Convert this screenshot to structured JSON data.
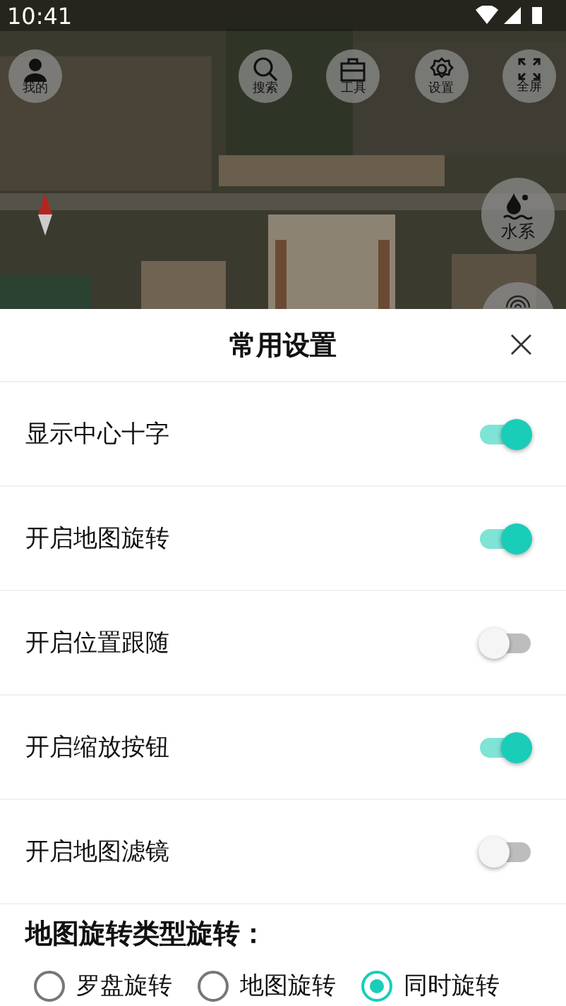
{
  "status_bar": {
    "time": "10:41"
  },
  "map_buttons": [
    {
      "label": "我的",
      "kind": "person"
    },
    {
      "label": "搜索",
      "kind": "search"
    },
    {
      "label": "工具",
      "kind": "toolbox"
    },
    {
      "label": "设置",
      "kind": "gear"
    },
    {
      "label": "全屏",
      "kind": "fullscreen"
    }
  ],
  "side_buttons": [
    {
      "label": "水系",
      "kind": "water"
    }
  ],
  "panel": {
    "title": "常用设置",
    "close": "×",
    "settings": [
      {
        "label": "显示中心十字",
        "on": true
      },
      {
        "label": "开启地图旋转",
        "on": true
      },
      {
        "label": "开启位置跟随",
        "on": false
      },
      {
        "label": "开启缩放按钮",
        "on": true
      },
      {
        "label": "开启地图滤镜",
        "on": false
      }
    ],
    "rotation_heading": "地图旋转类型旋转：",
    "rotation_options": [
      {
        "label": "罗盘旋转",
        "selected": false
      },
      {
        "label": "地图旋转",
        "selected": false
      },
      {
        "label": "同时旋转",
        "selected": true
      }
    ]
  }
}
